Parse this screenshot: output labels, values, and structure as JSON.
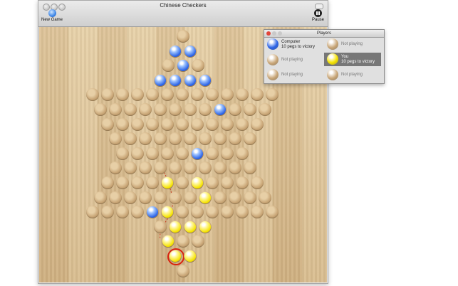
{
  "window": {
    "title": "Chinese Checkers",
    "toolbar": {
      "new_game_label": "New Game",
      "pause_label": "Pause"
    }
  },
  "board": {
    "rows": [
      {
        "offset": 0,
        "cells": [
          "e"
        ]
      },
      {
        "offset": 0,
        "cells": [
          "B",
          "B"
        ]
      },
      {
        "offset": 0,
        "cells": [
          "e",
          "B",
          "e"
        ]
      },
      {
        "offset": 0,
        "cells": [
          "B",
          "B",
          "B",
          "B"
        ]
      },
      {
        "offset": 0,
        "cells": [
          "e",
          "e",
          "e",
          "e",
          "e",
          "e",
          "e",
          "e",
          "e",
          "e",
          "e",
          "e",
          "e"
        ]
      },
      {
        "offset": 0,
        "cells": [
          "e",
          "e",
          "e",
          "e",
          "e",
          "e",
          "e",
          "e",
          "B",
          "e",
          "e",
          "e"
        ]
      },
      {
        "offset": 0,
        "cells": [
          "e",
          "e",
          "e",
          "e",
          "e",
          "e",
          "e",
          "e",
          "e",
          "e",
          "e"
        ]
      },
      {
        "offset": 0,
        "cells": [
          "e",
          "e",
          "e",
          "e",
          "e",
          "e",
          "e",
          "e",
          "e",
          "e"
        ]
      },
      {
        "offset": 0,
        "cells": [
          "e",
          "e",
          "e",
          "e",
          "e",
          "B",
          "e",
          "e",
          "e"
        ]
      },
      {
        "offset": 0,
        "cells": [
          "e",
          "e",
          "e",
          "e",
          "e",
          "e",
          "e",
          "e",
          "e",
          "e"
        ]
      },
      {
        "offset": 0,
        "cells": [
          "e",
          "e",
          "e",
          "e",
          "Y",
          "e",
          "Y",
          "e",
          "e",
          "e",
          "e"
        ]
      },
      {
        "offset": 0,
        "cells": [
          "e",
          "e",
          "e",
          "e",
          "e",
          "e",
          "e",
          "Y",
          "e",
          "e",
          "e",
          "e"
        ]
      },
      {
        "offset": 0,
        "cells": [
          "e",
          "e",
          "e",
          "e",
          "B",
          "Y",
          "e",
          "e",
          "e",
          "e",
          "e",
          "e",
          "e"
        ]
      },
      {
        "offset": 0,
        "cells": [
          "e",
          "Y",
          "Y",
          "Y"
        ]
      },
      {
        "offset": 0,
        "cells": [
          "Y",
          "e",
          "e"
        ]
      },
      {
        "offset": 0,
        "cells": [
          "Y",
          "Y"
        ]
      },
      {
        "offset": 0,
        "cells": [
          "e"
        ]
      }
    ],
    "selected_peg": {
      "row": 15,
      "col": 0
    }
  },
  "players_panel": {
    "title": "Players",
    "slots": [
      {
        "name": "Computer",
        "status": "10 pegs to victory",
        "color": "#2b63e6",
        "active": false
      },
      {
        "name": "",
        "status": "Not playing",
        "color": "#c9a677",
        "active": false
      },
      {
        "name": "",
        "status": "Not playing",
        "color": "#c9a677",
        "active": false
      },
      {
        "name": "",
        "status": "Not playing",
        "color": "#c9a677",
        "active": false
      },
      {
        "name": "You",
        "status": "10 pegs to victory",
        "color": "#f5e300",
        "active": true
      },
      {
        "name": "",
        "status": "Not playing",
        "color": "#c9a677",
        "active": false
      }
    ]
  }
}
